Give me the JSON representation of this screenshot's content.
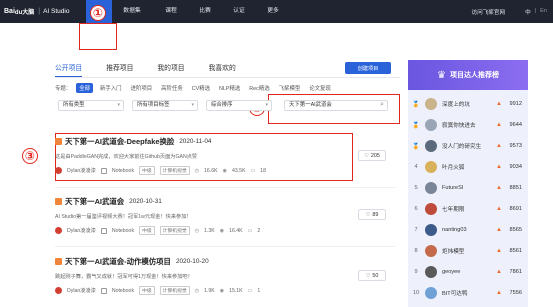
{
  "topbar": {
    "logo_brand": "Bai",
    "logo_paw": "du大脑",
    "logo_sep": "|",
    "logo_product": "AI Studio",
    "nav": [
      {
        "label": "项目",
        "active": true
      },
      {
        "label": "数据集",
        "active": false
      },
      {
        "label": "课程",
        "active": false
      },
      {
        "label": "比赛",
        "active": false
      },
      {
        "label": "认证",
        "active": false
      },
      {
        "label": "更多",
        "active": false
      }
    ],
    "official_site": "访问飞桨官网",
    "lang_zh": "中",
    "lang_sep": "|",
    "lang_en": "En"
  },
  "annotations": [
    "①",
    "②",
    "③"
  ],
  "tabs": [
    {
      "label": "公开项目",
      "active": true
    },
    {
      "label": "推荐项目",
      "active": false
    },
    {
      "label": "我的项目",
      "active": false
    },
    {
      "label": "我喜欢的",
      "active": false
    }
  ],
  "create_button": "创建项目",
  "filters": {
    "label": "专题：",
    "chips": [
      {
        "label": "全部",
        "active": true
      },
      {
        "label": "新手入门",
        "active": false
      },
      {
        "label": "进阶项目",
        "active": false
      },
      {
        "label": "高阶任务",
        "active": false
      },
      {
        "label": "CV精选",
        "active": false
      },
      {
        "label": "NLP精选",
        "active": false
      },
      {
        "label": "Rec精选",
        "active": false
      },
      {
        "label": "飞桨模型",
        "active": false
      },
      {
        "label": "论文复现",
        "active": false
      }
    ]
  },
  "selects": {
    "type": "所有类型",
    "tags": "所有项目标签",
    "sort": "综合排序"
  },
  "search": {
    "value": "天下第一AI武道会"
  },
  "projects": [
    {
      "title": "天下第一AI武道会-Deepfake换脸",
      "date": "2020-11-04",
      "desc": "这是由PaddleGAN完成，欢迎大家前往Github页面为GAN点赞",
      "author": "Dylan凌凌漆",
      "kind": "Notebook",
      "level": "中级",
      "field": "计算机视觉",
      "views": "16.6K",
      "forks": "43.5K",
      "comments": "18",
      "likes": "205"
    },
    {
      "title": "天下第一AI武道会",
      "date": "2020-10-31",
      "desc": "AI Studio第一届鉴评视频大赛！冠军1w元现金！快来参加！",
      "author": "Dylan凌凌漆",
      "kind": "Notebook",
      "level": "中级",
      "field": "计算机视觉",
      "views": "1.3K",
      "forks": "16.4K",
      "comments": "2",
      "likes": "89"
    },
    {
      "title": "天下第一AI武道会-动作模仿项目",
      "date": "2020-10-20",
      "desc": "跳起刚子舞，霸气又成就！冠军可得1万现金！快来参加吧！",
      "author": "Dylan凌凌漆",
      "kind": "Notebook",
      "level": "中级",
      "field": "计算机视觉",
      "views": "1.9K",
      "forks": "15.1K",
      "comments": "1",
      "likes": "50"
    }
  ],
  "ranking": {
    "title": "项目达人推荐榜",
    "rows": [
      {
        "rank": "1",
        "name": "深度上的坑",
        "score": "9912",
        "medal": "gold"
      },
      {
        "rank": "2",
        "name": "寂寞你快进去",
        "score": "9644",
        "medal": "silver"
      },
      {
        "rank": "3",
        "name": "没人门的研究生",
        "score": "9573",
        "medal": "bronze"
      },
      {
        "rank": "4",
        "name": "叶月火狐",
        "score": "9034",
        "medal": ""
      },
      {
        "rank": "5",
        "name": "FutureSI",
        "score": "8851",
        "medal": ""
      },
      {
        "rank": "6",
        "name": "七年期限",
        "score": "8691",
        "medal": ""
      },
      {
        "rank": "7",
        "name": "nanting03",
        "score": "8565",
        "medal": ""
      },
      {
        "rank": "8",
        "name": "炬炜模型",
        "score": "8561",
        "medal": ""
      },
      {
        "rank": "9",
        "name": "geoyee",
        "score": "7861",
        "medal": ""
      },
      {
        "rank": "10",
        "name": "BIT可达鸭",
        "score": "7556",
        "medal": ""
      }
    ]
  },
  "colors": {
    "accent": "#2a63d9",
    "topbar": "#1f2430",
    "annotation": "#e0281f",
    "rank_header": "#6a56e0"
  }
}
